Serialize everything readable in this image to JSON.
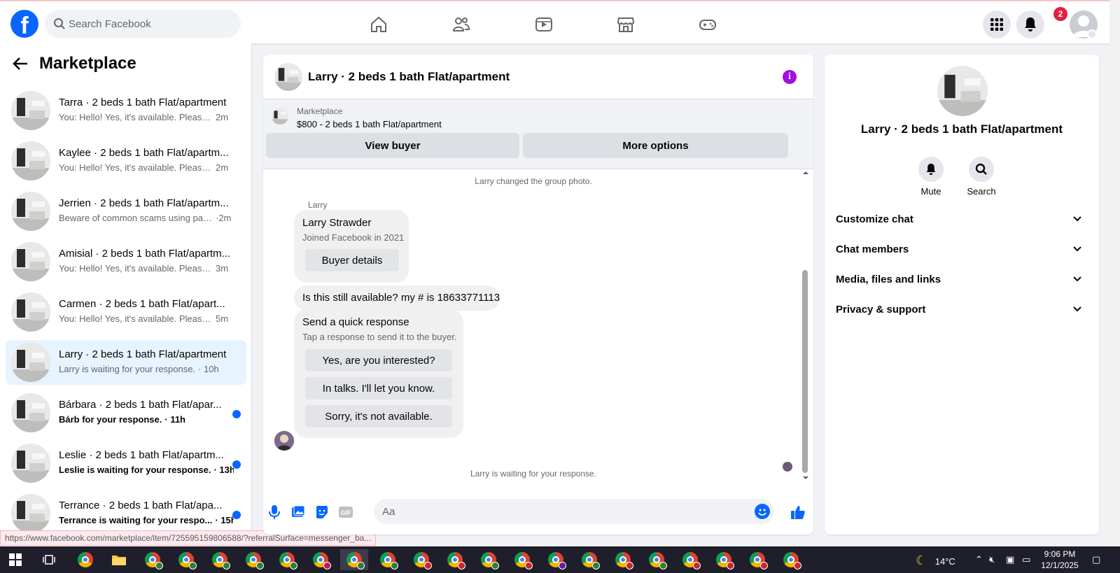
{
  "topbar": {
    "logo": "f",
    "search_placeholder": "Search Facebook",
    "notification_count": "2",
    "nav_icons": [
      "home-icon",
      "friends-icon",
      "video-icon",
      "marketplace-icon",
      "gaming-icon"
    ]
  },
  "sidebar": {
    "title": "Marketplace",
    "conversations": [
      {
        "title": "Tarra · 2 beds 1 bath Flat/apartment",
        "preview": "You: Hello! Yes, it's available. Please s...",
        "time": "2m",
        "unread": false,
        "active": false
      },
      {
        "title": "Kaylee · 2 beds 1 bath Flat/apartm...",
        "preview": "You: Hello! Yes, it's available. Please s...",
        "time": "2m",
        "unread": false,
        "active": false
      },
      {
        "title": "Jerrien · 2 beds 1 bath Flat/apartm...",
        "preview": "Beware of common scams using pay...",
        "time": "·2m",
        "unread": false,
        "active": false
      },
      {
        "title": "Amisial · 2 beds 1 bath Flat/apartm...",
        "preview": "You: Hello! Yes, it's available. Please s...",
        "time": "3m",
        "unread": false,
        "active": false
      },
      {
        "title": "Carmen · 2 beds 1 bath Flat/apart...",
        "preview": "You: Hello! Yes, it's available. Please s...",
        "time": "5m",
        "unread": false,
        "active": false
      },
      {
        "title": "Larry · 2 beds 1 bath Flat/apartment",
        "preview": "Larry is waiting for your response.",
        "time": "· 10h",
        "unread": false,
        "active": true
      },
      {
        "title": "Bárbara · 2 beds 1 bath Flat/apar...",
        "preview": "Bárb for your response.",
        "time": "· 11h",
        "unread": true,
        "active": false
      },
      {
        "title": "Leslie · 2 beds 1 bath Flat/apartm...",
        "preview": "Leslie is waiting for your response.",
        "time": "· 13h",
        "unread": true,
        "active": false
      },
      {
        "title": "Terrance · 2 beds 1 bath Flat/apa...",
        "preview": "Terrance is waiting for your respo...",
        "time": "· 15h",
        "unread": true,
        "active": false
      }
    ]
  },
  "status_url": "https://www.facebook.com/marketplace/item/725595159806588/?referralSurface=messenger_ba...",
  "chat": {
    "header_title": "Larry · 2 beds 1 bath Flat/apartment",
    "listing": {
      "category": "Marketplace",
      "title": "$800 - 2 beds 1 bath Flat/apartment",
      "view_buyer_label": "View buyer",
      "more_options_label": "More options"
    },
    "system_group_photo": "Larry changed the group photo.",
    "sender_name": "Larry",
    "profile_card": {
      "name": "Larry Strawder",
      "joined": "Joined Facebook in 2021",
      "button": "Buyer details"
    },
    "message": "Is this still available? my # is 18633771113",
    "quick_response": {
      "title": "Send a quick response",
      "hint": "Tap a response to send it to the buyer.",
      "options": [
        "Yes, are you interested?",
        "In talks. I'll let you know.",
        "Sorry, it's not available."
      ]
    },
    "waiting_status": "Larry is waiting for your response.",
    "composer_placeholder": "Aa",
    "gif_label": "GIF"
  },
  "info_panel": {
    "title": "Larry · 2 beds 1 bath Flat/apartment",
    "mute_label": "Mute",
    "search_label": "Search",
    "sections": [
      "Customize chat",
      "Chat members",
      "Media, files and links",
      "Privacy & support"
    ]
  },
  "taskbar": {
    "weather": "14°C",
    "time": "9:06 PM",
    "date": "12/1/2025"
  },
  "colors": {
    "brand_blue": "#0866ff",
    "info_purple": "#a20ee3",
    "unread_dot": "#0866ff",
    "active_row": "#e7f3ff"
  }
}
